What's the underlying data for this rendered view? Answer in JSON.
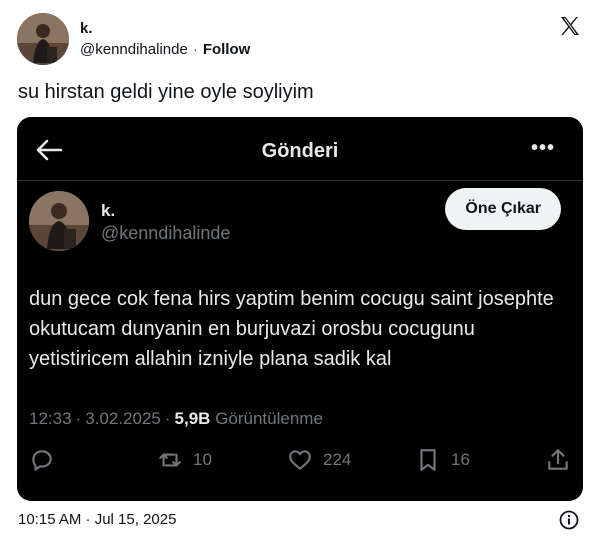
{
  "outer": {
    "name": "k.",
    "handle": "@kenndihalinde",
    "separator": "·",
    "follow_label": "Follow",
    "text": "su hirstan geldi yine oyle soyliyim",
    "footer_time": "10:15 AM · Jul 15, 2025"
  },
  "card": {
    "title": "Gönderi",
    "more": "•••",
    "name": "k.",
    "handle": "@kenndihalinde",
    "highlight_button": "Öne Çıkar",
    "text": "dun gece cok fena hirs yaptim benim cocugu saint josephte okutucam dunyanin en burjuvazi orosbu cocugunu yetistiricem allahin izniyle plana sadik kal",
    "time": "12:33",
    "date": "3.02.2025",
    "sep": "·",
    "views_count": "5,9B",
    "views_label": "Görüntülenme",
    "retweets": "10",
    "likes": "224",
    "bookmarks": "16"
  },
  "colors": {
    "card_bg": "#000000",
    "secondary_text": "#71767b",
    "primary_text_dark": "#e7e9ea"
  },
  "icons": [
    "x-logo-icon",
    "back-arrow-icon",
    "more-icon",
    "reply-icon",
    "retweet-icon",
    "like-icon",
    "bookmark-icon",
    "share-icon",
    "info-icon"
  ]
}
